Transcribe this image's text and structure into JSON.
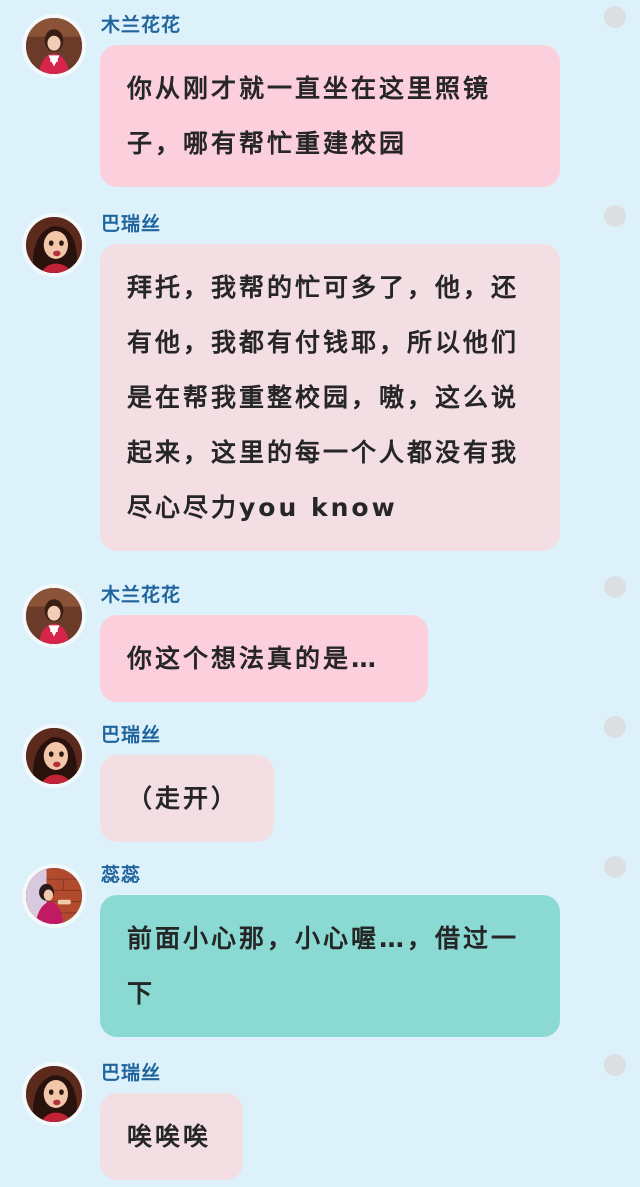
{
  "messages": [
    {
      "sender": "木兰花花",
      "text": "你从刚才就一直坐在这里照镜子，哪有帮忙重建校园",
      "bubble_color": "#fccfdc",
      "avatar": "mulan-avatar"
    },
    {
      "sender": "巴瑞丝",
      "text": "拜托，我帮的忙可多了，他，还有他，我都有付钱耶，所以他们是在帮我重整校园，嗷，这么说起来，这里的每一个人都没有我尽心尽力you know",
      "bubble_color": "#f3dfe3",
      "avatar": "barisi-avatar"
    },
    {
      "sender": "木兰花花",
      "text": "你这个想法真的是…",
      "bubble_color": "#fccfdc",
      "avatar": "mulan-avatar"
    },
    {
      "sender": "巴瑞丝",
      "text": "（走开）",
      "bubble_color": "#f3dfe3",
      "avatar": "barisi-avatar"
    },
    {
      "sender": "蕊蕊",
      "text": "前面小心那，小心喔…，借过一下",
      "bubble_color": "#8ad9d2",
      "avatar": "ruirui-avatar"
    },
    {
      "sender": "巴瑞丝",
      "text": "唉唉唉",
      "bubble_color": "#f3dfe3",
      "avatar": "barisi-avatar"
    }
  ]
}
